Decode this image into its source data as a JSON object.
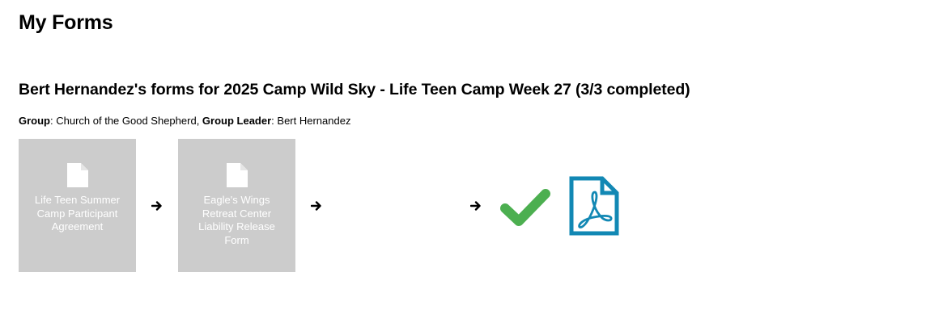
{
  "page": {
    "title": "My Forms"
  },
  "registration": {
    "heading": "Bert Hernandez's forms for 2025 Camp Wild Sky - Life Teen Camp Week 27 (3/3 completed)",
    "group_label": "Group",
    "group_value": "Church of the Good Shepherd",
    "leader_label": "Group Leader",
    "leader_value": "Bert Hernandez"
  },
  "forms": [
    {
      "label": "Life Teen Summer Camp Participant Agreement",
      "icon": "document-icon"
    },
    {
      "label": "Eagle's Wings Retreat Center Liability Release Form",
      "icon": "document-icon"
    }
  ],
  "status": {
    "completed_icon": "checkmark-icon",
    "download_icon": "pdf-icon"
  },
  "colors": {
    "tile_background": "#cccccc",
    "tile_text": "#ffffff",
    "check_green": "#4caf50",
    "pdf_blue": "#1288b4"
  }
}
